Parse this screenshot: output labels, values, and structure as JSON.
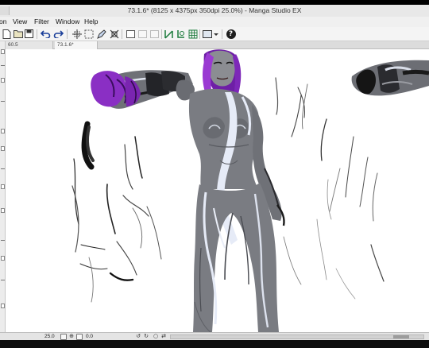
{
  "window": {
    "title": "73.1.6* (8125 x 4375px 350dpi 25.0%) - Manga Studio EX",
    "app_name": "Manga Studio EX"
  },
  "menu": {
    "items": [
      "on",
      "View",
      "Filter",
      "Window",
      "Help"
    ]
  },
  "toolbar": {
    "icons": [
      "new-page-icon",
      "open-icon",
      "save-icon",
      "undo-icon",
      "redo-icon",
      "transform-icon",
      "select-all-icon",
      "pen-icon",
      "crop-icon",
      "layer-square-icon",
      "layer-square-faint-icon",
      "snap-ruler-icon",
      "snap-special-icon",
      "snap-grid-icon",
      "view-mode-icon",
      "help-icon"
    ],
    "help_label": "?"
  },
  "tabs": [
    {
      "label": "60.5"
    },
    {
      "label": "73.1.6*"
    }
  ],
  "status": {
    "zoom": "25.0",
    "rotation": "0.0"
  },
  "colors": {
    "canvas": "#ffffff",
    "hair": "#8a2fc4",
    "skin_gray": "#7a7c82",
    "suit_highlight": "#e6ebf7",
    "ink": "#0f0f0f"
  }
}
